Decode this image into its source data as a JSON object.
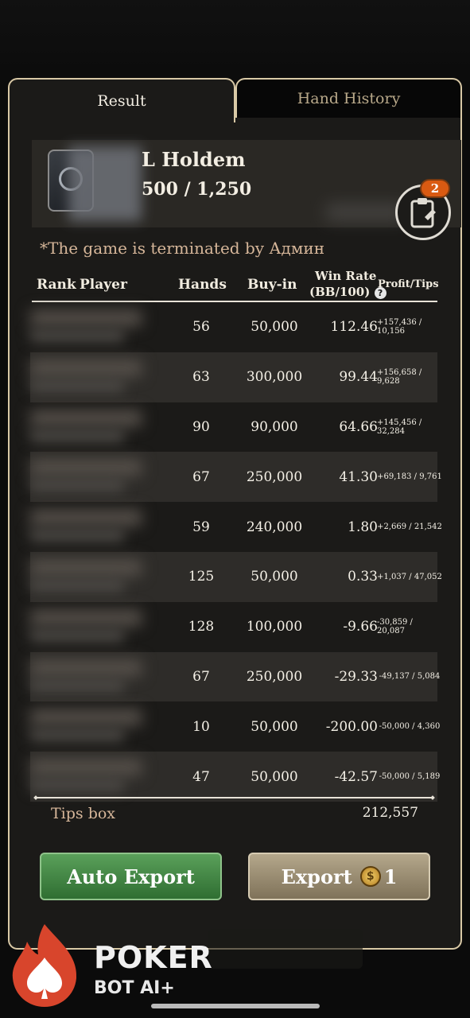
{
  "tabs": {
    "result": "Result",
    "hand_history": "Hand History"
  },
  "game": {
    "name": "L Holdem",
    "blinds": "500 / 1,250",
    "badge_count": "2"
  },
  "termination_notice": "*The game is terminated by Админ",
  "table": {
    "headers": {
      "rank": "Rank",
      "player": "Player",
      "hands": "Hands",
      "buyin": "Buy-in",
      "winrate_line1": "Win Rate",
      "winrate_line2": "(BB/100)",
      "profit_tips": "Profit/Tips",
      "help": "?"
    },
    "rows": [
      {
        "hands": "56",
        "buyin": "50,000",
        "winrate": "112.46",
        "profit_tips": "+157,436 / 10,156"
      },
      {
        "hands": "63",
        "buyin": "300,000",
        "winrate": "99.44",
        "profit_tips": "+156,658 / 9,628"
      },
      {
        "hands": "90",
        "buyin": "90,000",
        "winrate": "64.66",
        "profit_tips": "+145,456 / 32,284"
      },
      {
        "hands": "67",
        "buyin": "250,000",
        "winrate": "41.30",
        "profit_tips": "+69,183 / 9,761"
      },
      {
        "hands": "59",
        "buyin": "240,000",
        "winrate": "1.80",
        "profit_tips": "+2,669 / 21,542"
      },
      {
        "hands": "125",
        "buyin": "50,000",
        "winrate": "0.33",
        "profit_tips": "+1,037 / 47,052"
      },
      {
        "hands": "128",
        "buyin": "100,000",
        "winrate": "-9.66",
        "profit_tips": "-30,859 / 20,087"
      },
      {
        "hands": "67",
        "buyin": "250,000",
        "winrate": "-29.33",
        "profit_tips": "-49,137 / 5,084"
      },
      {
        "hands": "10",
        "buyin": "50,000",
        "winrate": "-200.00",
        "profit_tips": "-50,000 / 4,360"
      },
      {
        "hands": "47",
        "buyin": "50,000",
        "winrate": "-42.57",
        "profit_tips": "-50,000 / 5,189"
      }
    ]
  },
  "tips_box": {
    "label": "Tips box",
    "value": "212,557"
  },
  "buttons": {
    "auto_export": "Auto Export",
    "export": "Export",
    "export_cost": "1",
    "coin_symbol": "$"
  },
  "watermark": {
    "line1": "POKER",
    "line2": "BOT AI+"
  },
  "colors": {
    "accent_green": "#3f8a41",
    "accent_tan": "#9d8f72",
    "badge_orange": "#d95a12",
    "tab_border": "#d9c9a6"
  }
}
